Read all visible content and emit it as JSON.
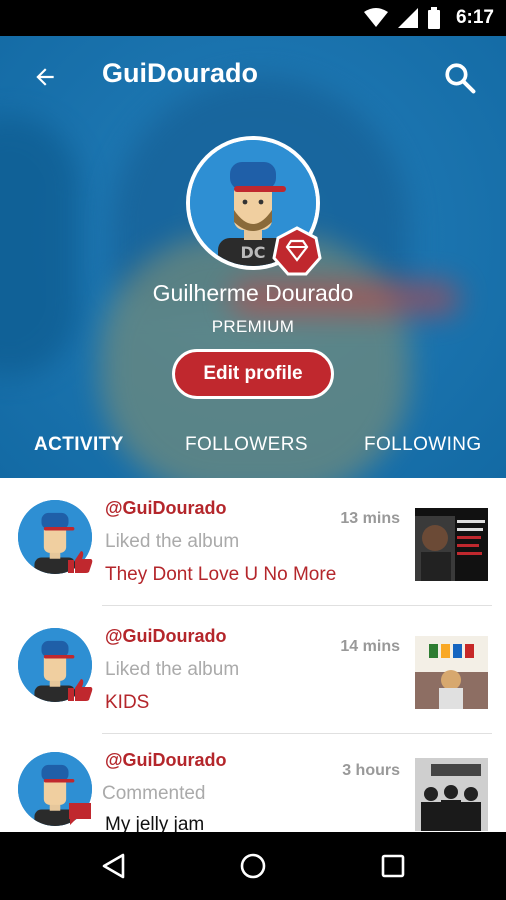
{
  "status_bar": {
    "time": "6:17"
  },
  "app_bar": {
    "title": "GuiDourado"
  },
  "profile": {
    "name": "Guilherme Dourado",
    "tier": "PREMIUM",
    "edit_label": "Edit profile"
  },
  "tabs": [
    {
      "label": "ACTIVITY",
      "active": true
    },
    {
      "label": "FOLLOWERS",
      "active": false
    },
    {
      "label": "FOLLOWING",
      "active": false
    }
  ],
  "feed": [
    {
      "handle": "@GuiDourado",
      "action": "Liked the album",
      "target": "They Dont Love U No More",
      "time": "13 mins",
      "badge": "thumbs-up-icon"
    },
    {
      "handle": "@GuiDourado",
      "action": "Liked the album",
      "target": "KIDS",
      "time": "14 mins",
      "badge": "thumbs-up-icon"
    },
    {
      "handle": "@GuiDourado",
      "action": "Commented",
      "target": "My jelly jam",
      "time": "3 hours",
      "badge": "comment-icon"
    }
  ],
  "colors": {
    "accent": "#c0282e",
    "header_blue": "#1c75b0",
    "handle_red": "#b4262b"
  }
}
